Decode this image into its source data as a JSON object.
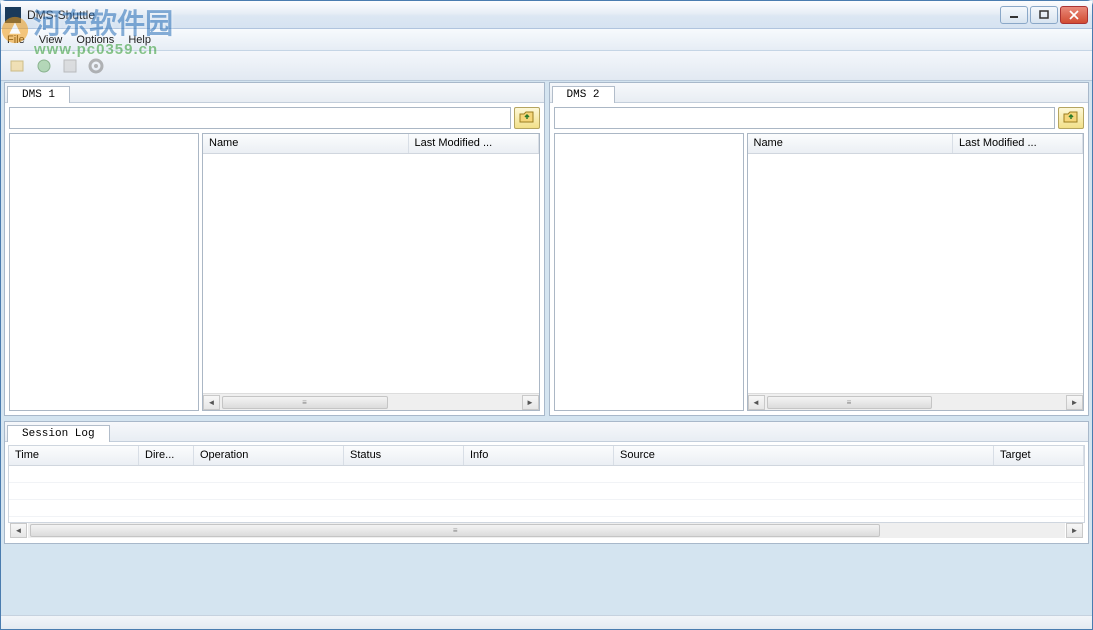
{
  "window": {
    "title": "DMS-Shuttle"
  },
  "menu": {
    "file": "File",
    "view": "View",
    "options": "Options",
    "help": "Help"
  },
  "panels": {
    "left": {
      "tab": "DMS 1",
      "columns": {
        "name": "Name",
        "modified": "Last Modified ..."
      }
    },
    "right": {
      "tab": "DMS 2",
      "columns": {
        "name": "Name",
        "modified": "Last Modified ..."
      }
    }
  },
  "log": {
    "tab": "Session Log",
    "columns": {
      "time": "Time",
      "direction": "Dire...",
      "operation": "Operation",
      "status": "Status",
      "info": "Info",
      "source": "Source",
      "target": "Target"
    }
  },
  "watermark": {
    "site_cn": "河东软件园",
    "url": "www.pc0359.cn"
  }
}
